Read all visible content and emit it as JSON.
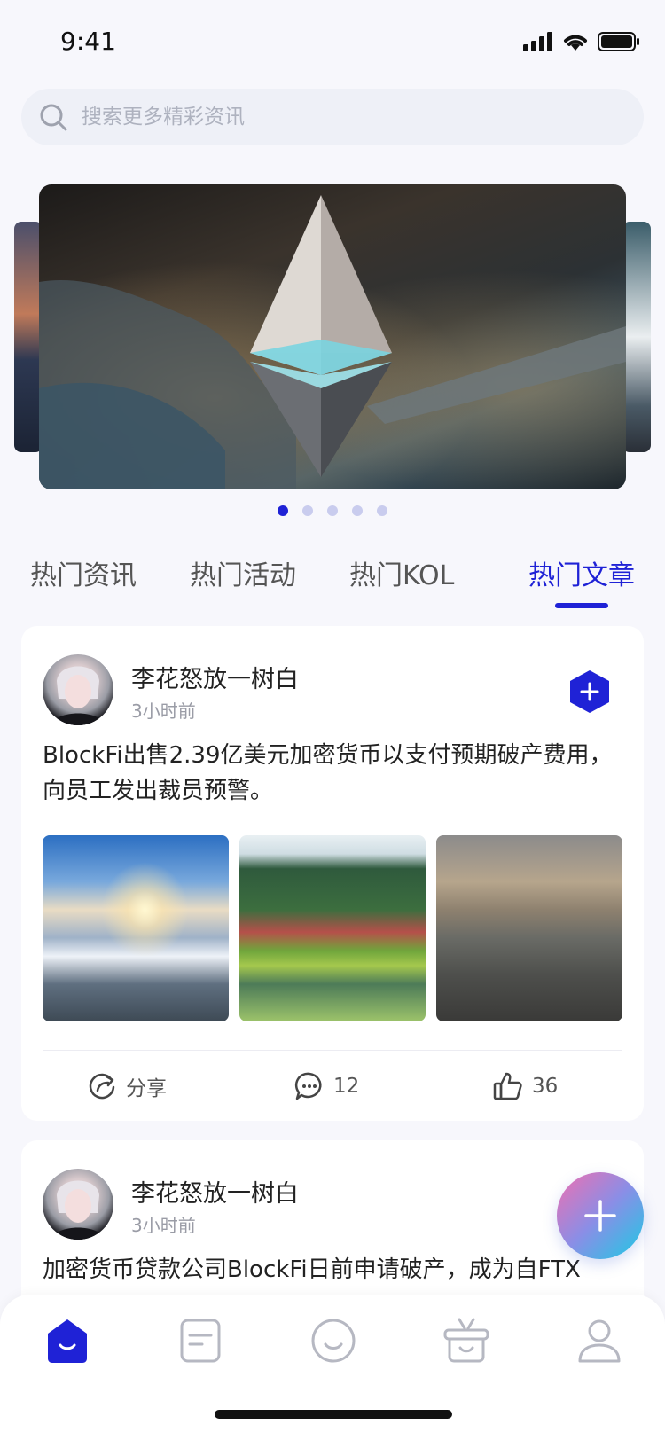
{
  "status_bar": {
    "time": "9:41"
  },
  "search": {
    "placeholder": "搜索更多精彩资讯"
  },
  "banner": {
    "pages": 5,
    "active_page": 1
  },
  "tabs": [
    {
      "label": "热门资讯",
      "active": false
    },
    {
      "label": "热门活动",
      "active": false
    },
    {
      "label": "热门KOL",
      "active": false
    },
    {
      "label": "热门文章",
      "active": true
    }
  ],
  "posts": [
    {
      "author": "李花怒放一树白",
      "time": "3小时前",
      "text": "BlockFi出售2.39亿美元加密货币以支付预期破产费用，向员工发出裁员预警。",
      "actions": {
        "share_label": "分享",
        "comments": "12",
        "likes": "36"
      }
    },
    {
      "author": "李花怒放一树白",
      "time": "3小时前",
      "text": "加密货币贷款公司BlockFi日前申请破产，成为自FTX"
    }
  ],
  "colors": {
    "accent": "#1f22d6",
    "background": "#f7f7fc",
    "muted": "#9a9ca6"
  },
  "icons": {
    "search": "search-icon",
    "follow": "hex-plus-icon",
    "share": "share-icon",
    "comment": "comment-icon",
    "like": "thumbs-up-icon",
    "fab": "plus-icon",
    "nav": [
      "home-icon",
      "document-icon",
      "smile-icon",
      "basket-icon",
      "profile-icon"
    ]
  }
}
